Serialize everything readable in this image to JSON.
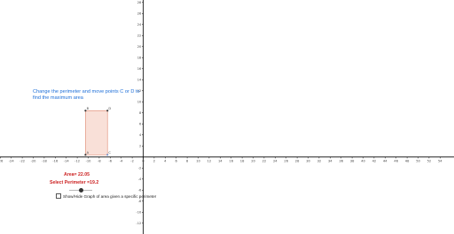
{
  "instruction_text": "Change the perimeter and move points C or D to find the maximum area",
  "area_label": "Area= 22.05",
  "perimeter_label": "Select Perimeter =19.2",
  "checkbox_label": "Show/Hide Graph of area given a specific perimeter",
  "perimeter_slider": {
    "value": 19.2
  },
  "checkbox_checked": false,
  "graph": {
    "x_ticks": [
      "-26",
      "-24",
      "-22",
      "-20",
      "-18",
      "-16",
      "-14",
      "-12",
      "-10",
      "-8",
      "-6",
      "-4",
      "-2",
      "0",
      "2",
      "4",
      "6",
      "8",
      "10",
      "12",
      "14",
      "16",
      "18",
      "20",
      "22",
      "24",
      "26",
      "28",
      "30",
      "32",
      "34",
      "36",
      "38",
      "40",
      "42",
      "44",
      "46",
      "48",
      "50",
      "52",
      "54"
    ],
    "y_ticks": [
      "28",
      "26",
      "24",
      "22",
      "20",
      "18",
      "16",
      "14",
      "12",
      "10",
      "8",
      "6",
      "4",
      "2",
      "-2",
      "-4",
      "-6",
      "-8",
      "-10",
      "-12"
    ],
    "points": [
      {
        "label": "A",
        "x": -10.5,
        "y": 0.4
      },
      {
        "label": "B",
        "x": -10.5,
        "y": 8.4
      },
      {
        "label": "C",
        "x": -6.5,
        "y": 0.4
      },
      {
        "label": "D",
        "x": -6.5,
        "y": 8.4
      }
    ],
    "colors": {
      "rect_fill": "#f9e0d8",
      "rect_stroke": "#e08a72",
      "point_dark": "#333333",
      "point_blue": "#6f8fc8",
      "text_red": "#cc2222",
      "text_blue": "#1c6ed8"
    }
  }
}
